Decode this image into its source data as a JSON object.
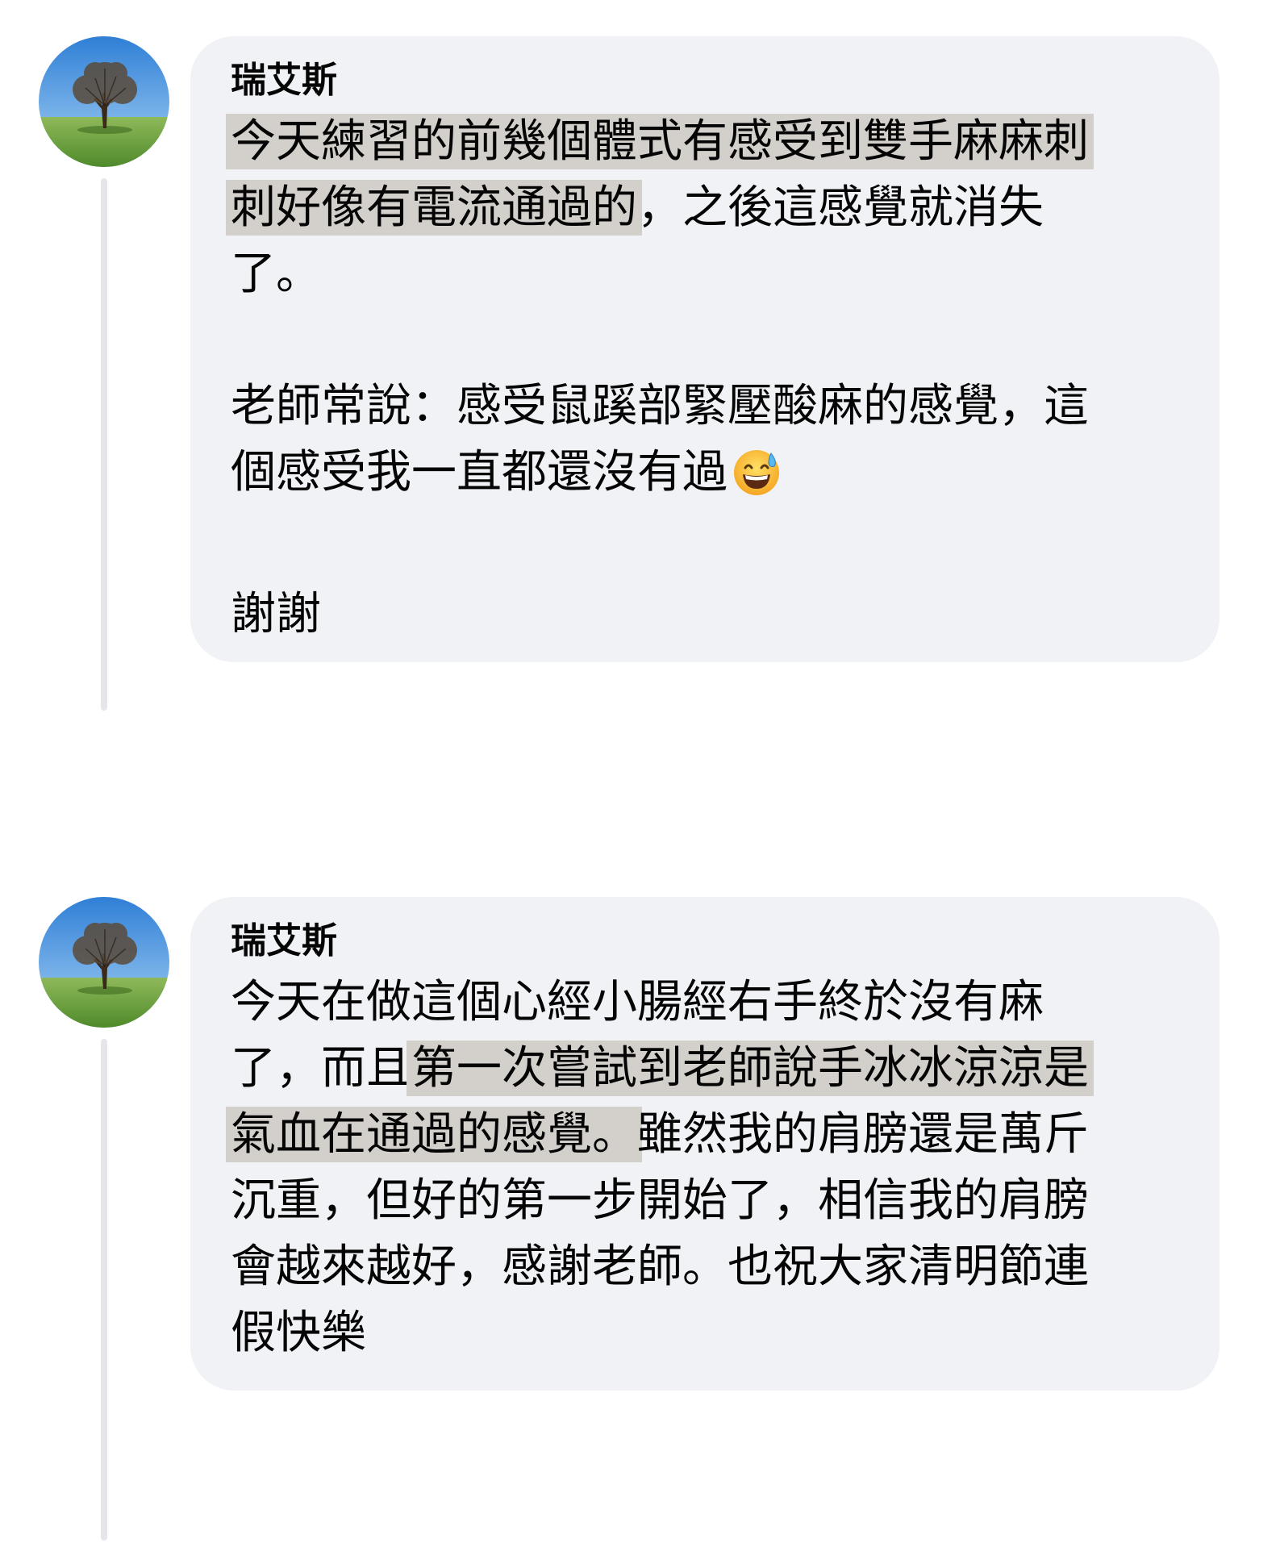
{
  "comments": [
    {
      "author": "瑞艾斯",
      "avatar_icon": "tree-avatar-icon",
      "lines": [
        {
          "highlight": "今天練習的前幾個體式有感受到雙手麻麻刺",
          "plain": ""
        },
        {
          "highlight": "刺好像有電流通過的",
          "plain": "，之後這感覺就消失"
        },
        {
          "plain": "了。"
        },
        {
          "plain": "老師常說：感受鼠蹊部緊壓酸麻的感覺，這"
        },
        {
          "plain": "個感受我一直都還沒有過",
          "emoji": "grinning-sweat-emoji"
        },
        {
          "plain": "謝謝"
        }
      ]
    },
    {
      "author": "瑞艾斯",
      "avatar_icon": "tree-avatar-icon",
      "lines": [
        {
          "plain": "今天在做這個心經小腸經右手終於沒有麻"
        },
        {
          "before": "了，而且",
          "highlight": "第一次嘗試到老師說手冰冰涼涼是"
        },
        {
          "highlight": "氣血在通過的感覺。",
          "plain": "雖然我的肩膀還是萬斤"
        },
        {
          "plain": "沉重，但好的第一步開始了，相信我的肩膀"
        },
        {
          "plain": "會越來越好，感謝老師。也祝大家清明節連"
        },
        {
          "plain": "假快樂"
        }
      ]
    }
  ],
  "colors": {
    "bubble_bg": "#f0f2f5",
    "highlight_bg": "#d3cfcb",
    "thread_line": "#e4e6eb"
  }
}
